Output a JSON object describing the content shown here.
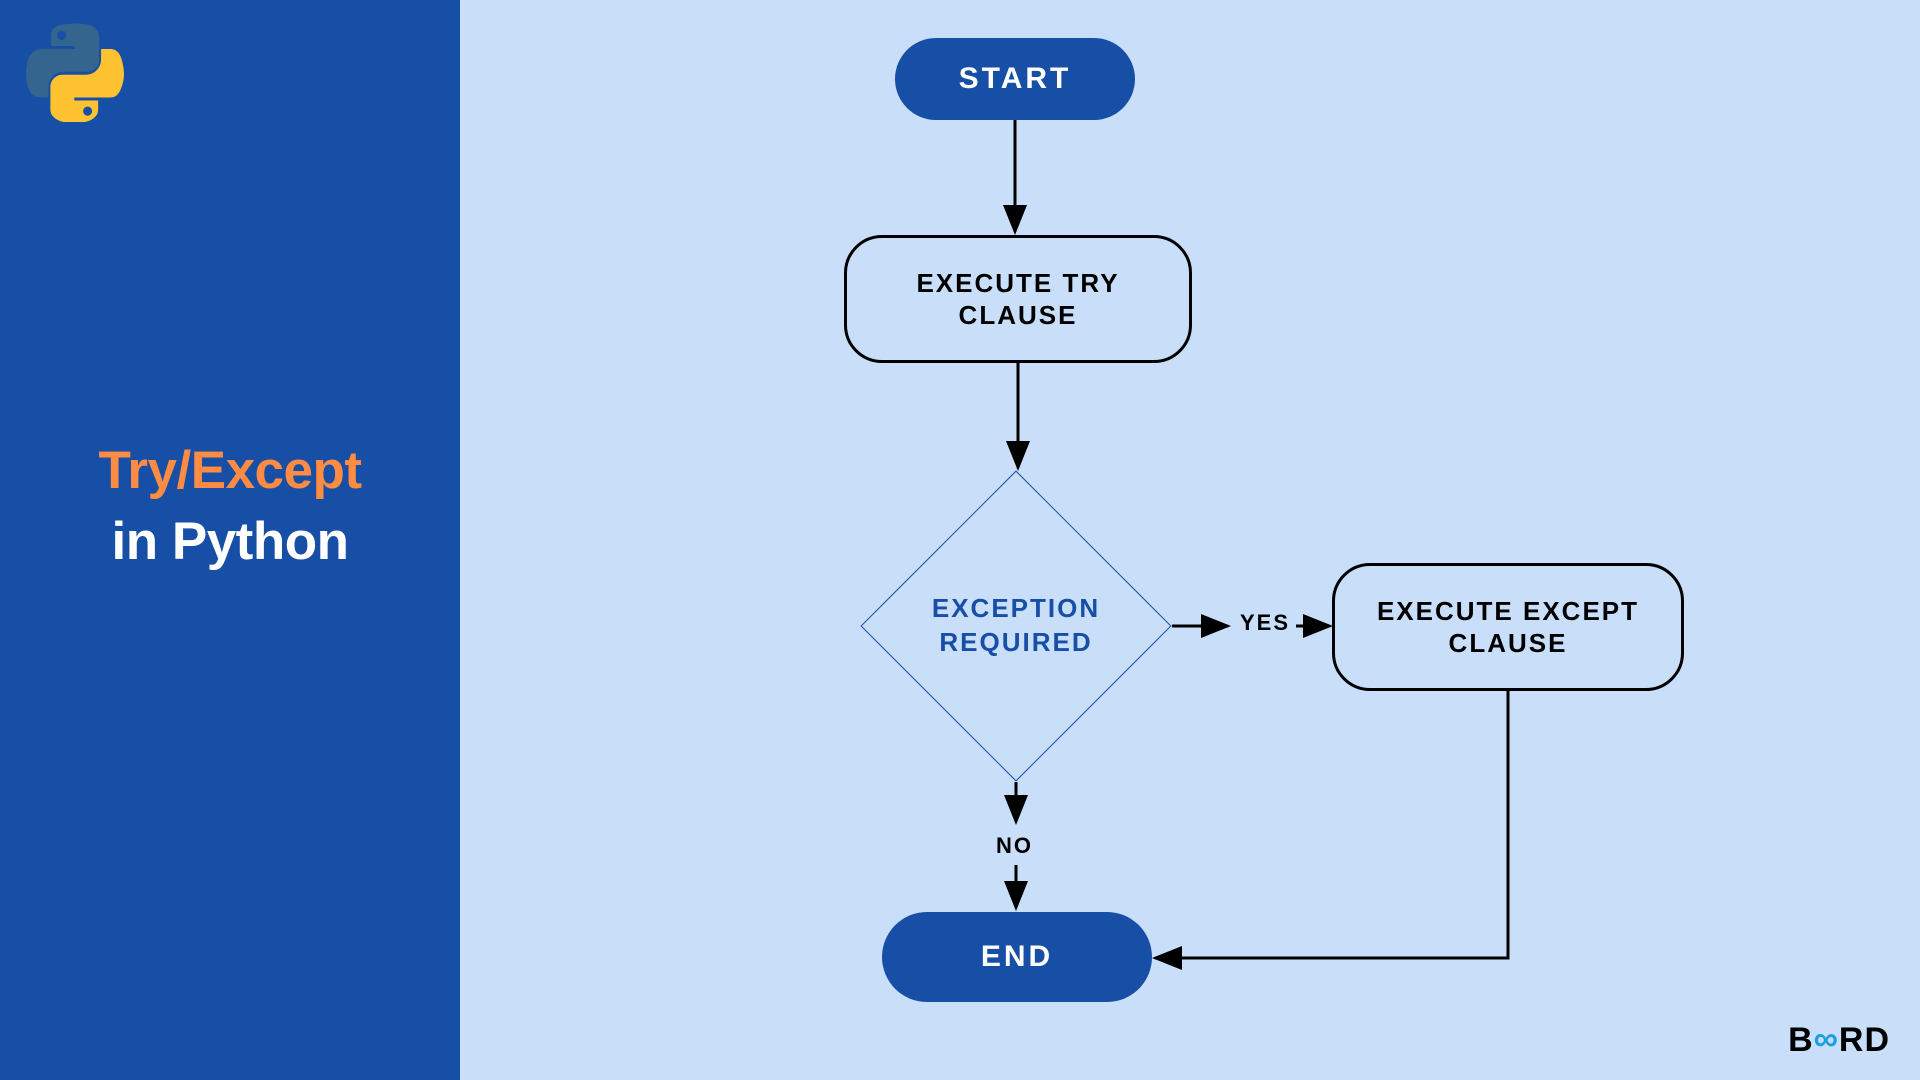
{
  "sidebar": {
    "title_line1": "Try/Except",
    "title_line2": "in Python"
  },
  "flow": {
    "start": "START",
    "try": "EXECUTE TRY CLAUSE",
    "decision": "EXCEPTION REQUIRED",
    "except": "EXECUTE EXCEPT CLAUSE",
    "end": "END",
    "yes": "YES",
    "no": "NO"
  },
  "brand": {
    "prefix": "B",
    "infinity": "∞",
    "suffix": "RD"
  },
  "colors": {
    "sidebar_bg": "#174ea6",
    "page_bg": "#c9def9",
    "accent_orange": "#ff8c42",
    "brand_blue": "#1a9ee6"
  }
}
